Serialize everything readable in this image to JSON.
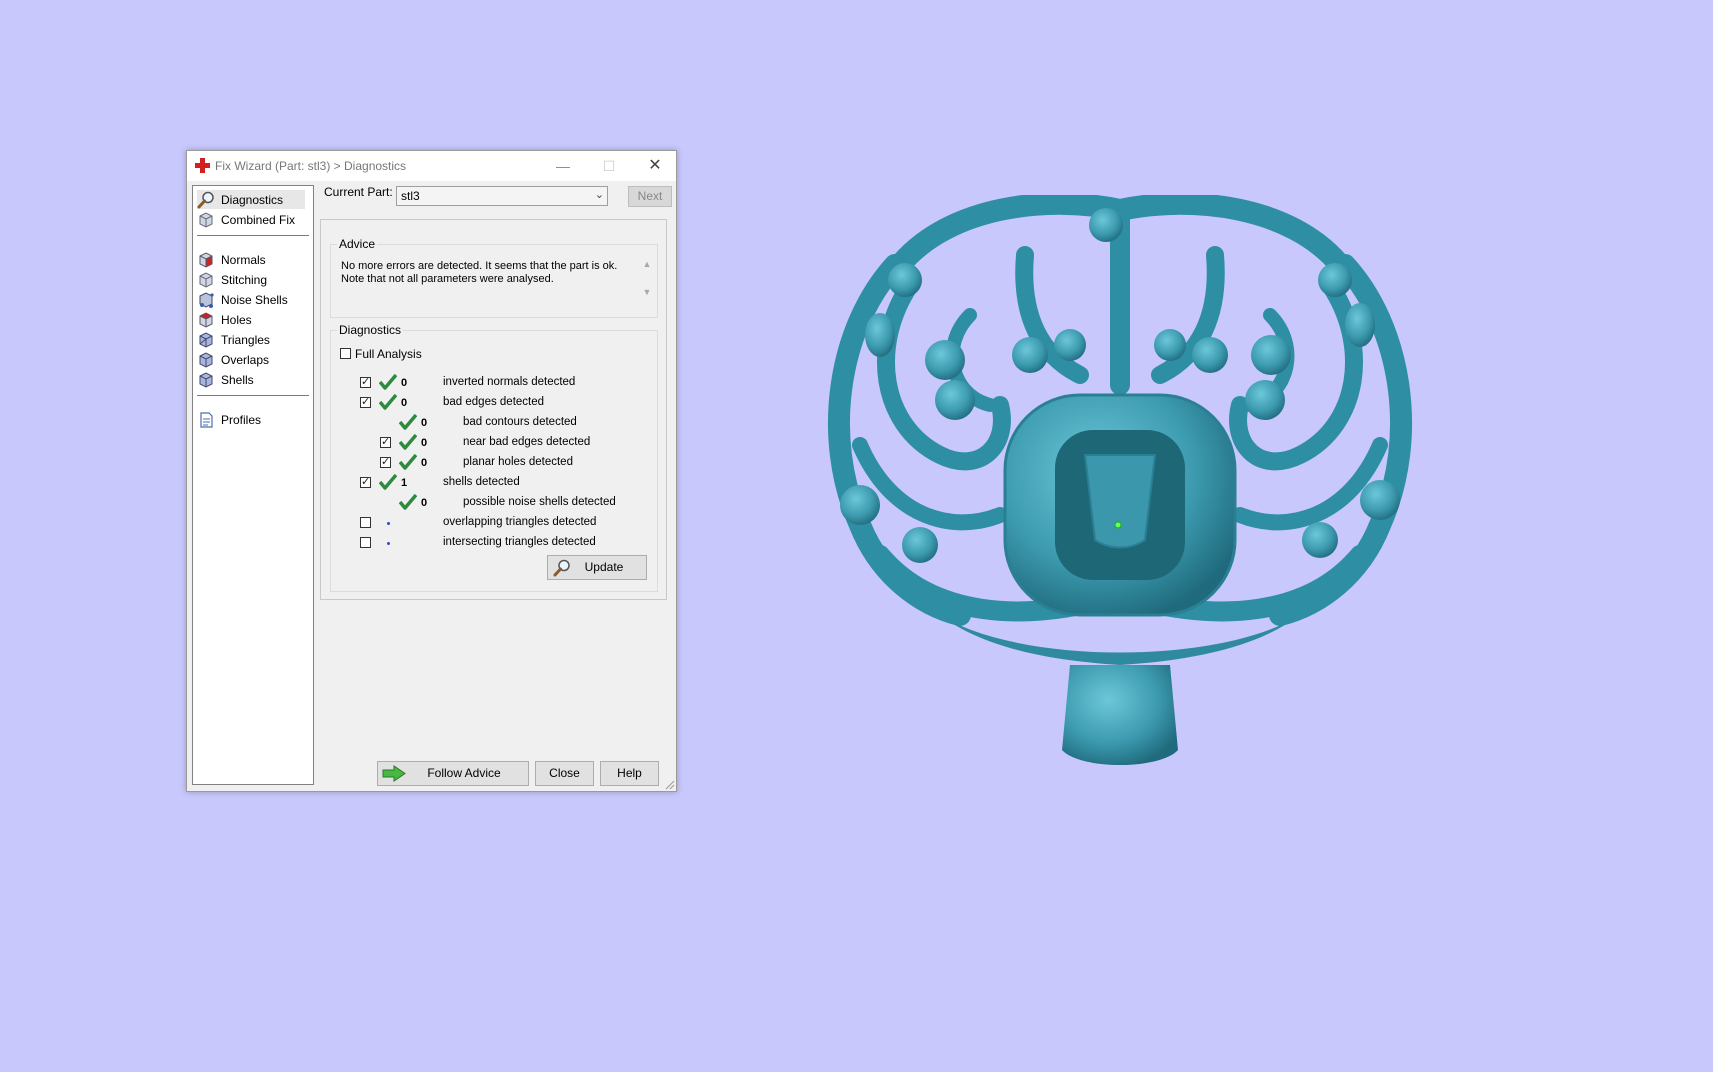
{
  "window": {
    "title": "Fix Wizard (Part: stl3) > Diagnostics",
    "minimize": "—",
    "maximize": "☐",
    "close": "✕"
  },
  "nav": {
    "items": [
      {
        "label": "Diagnostics",
        "icon": "magnifier-icon",
        "selected": true
      },
      {
        "label": "Combined Fix",
        "icon": "cube-icon"
      },
      {
        "label": "Normals",
        "icon": "cube-red-icon"
      },
      {
        "label": "Stitching",
        "icon": "cube-icon"
      },
      {
        "label": "Noise Shells",
        "icon": "noise-shells-icon"
      },
      {
        "label": "Holes",
        "icon": "cube-red-icon"
      },
      {
        "label": "Triangles",
        "icon": "cube-blue-icon"
      },
      {
        "label": "Overlaps",
        "icon": "cube-blue-icon"
      },
      {
        "label": "Shells",
        "icon": "cube-blue-icon"
      },
      {
        "label": "Profiles",
        "icon": "document-icon"
      }
    ]
  },
  "current_part": {
    "label": "Current Part:",
    "value": "stl3"
  },
  "next_label": "Next",
  "advice": {
    "title": "Advice",
    "text": "No more errors are detected. It seems that the part is ok. Note that not all parameters were analysed."
  },
  "diagnostics": {
    "title": "Diagnostics",
    "full_analysis_label": "Full Analysis",
    "full_analysis_checked": false,
    "rows": [
      {
        "checked": true,
        "status": "ok",
        "value": "0",
        "label": "inverted normals detected"
      },
      {
        "checked": true,
        "status": "ok",
        "value": "0",
        "label": "bad edges detected"
      },
      {
        "checked": null,
        "status": "ok",
        "value": "0",
        "label": "bad contours detected"
      },
      {
        "checked": true,
        "status": "ok",
        "value": "0",
        "label": "near bad edges detected"
      },
      {
        "checked": true,
        "status": "ok",
        "value": "0",
        "label": "planar holes detected"
      },
      {
        "checked": true,
        "status": "ok",
        "value": "1",
        "label": "shells detected"
      },
      {
        "checked": null,
        "status": "ok",
        "value": "0",
        "label": "possible noise shells detected"
      },
      {
        "checked": false,
        "status": "not-analysed",
        "value": "",
        "label": "overlapping triangles detected"
      },
      {
        "checked": false,
        "status": "not-analysed",
        "value": "",
        "label": "intersecting triangles detected"
      }
    ],
    "update_label": "Update"
  },
  "buttons": {
    "follow_advice": "Follow Advice",
    "close": "Close",
    "help": "Help"
  },
  "colors": {
    "background": "#c8c8fc",
    "model": "#3d9bb0",
    "ok_tick": "#2e8b3e",
    "arrow": "#49b843"
  }
}
